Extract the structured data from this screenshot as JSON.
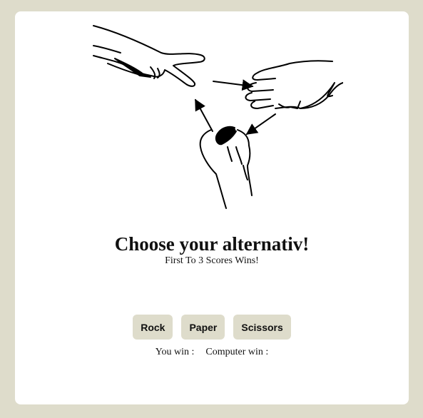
{
  "game": {
    "title": "Choose your alternativ!",
    "subtitle": "First To 3 Scores Wins!",
    "buttons": {
      "rock": "Rock",
      "paper": "Paper",
      "scissors": "Scissors"
    },
    "scores": {
      "player_label": "You win :",
      "computer_label": "Computer win :"
    }
  },
  "illustration": {
    "icons": [
      "scissors-hand-icon",
      "paper-hand-icon",
      "rock-fist-icon",
      "cycle-arrow-icon"
    ]
  },
  "colors": {
    "background": "#dedccb",
    "card": "#ffffff",
    "button": "#dedccb",
    "text": "#111111"
  }
}
